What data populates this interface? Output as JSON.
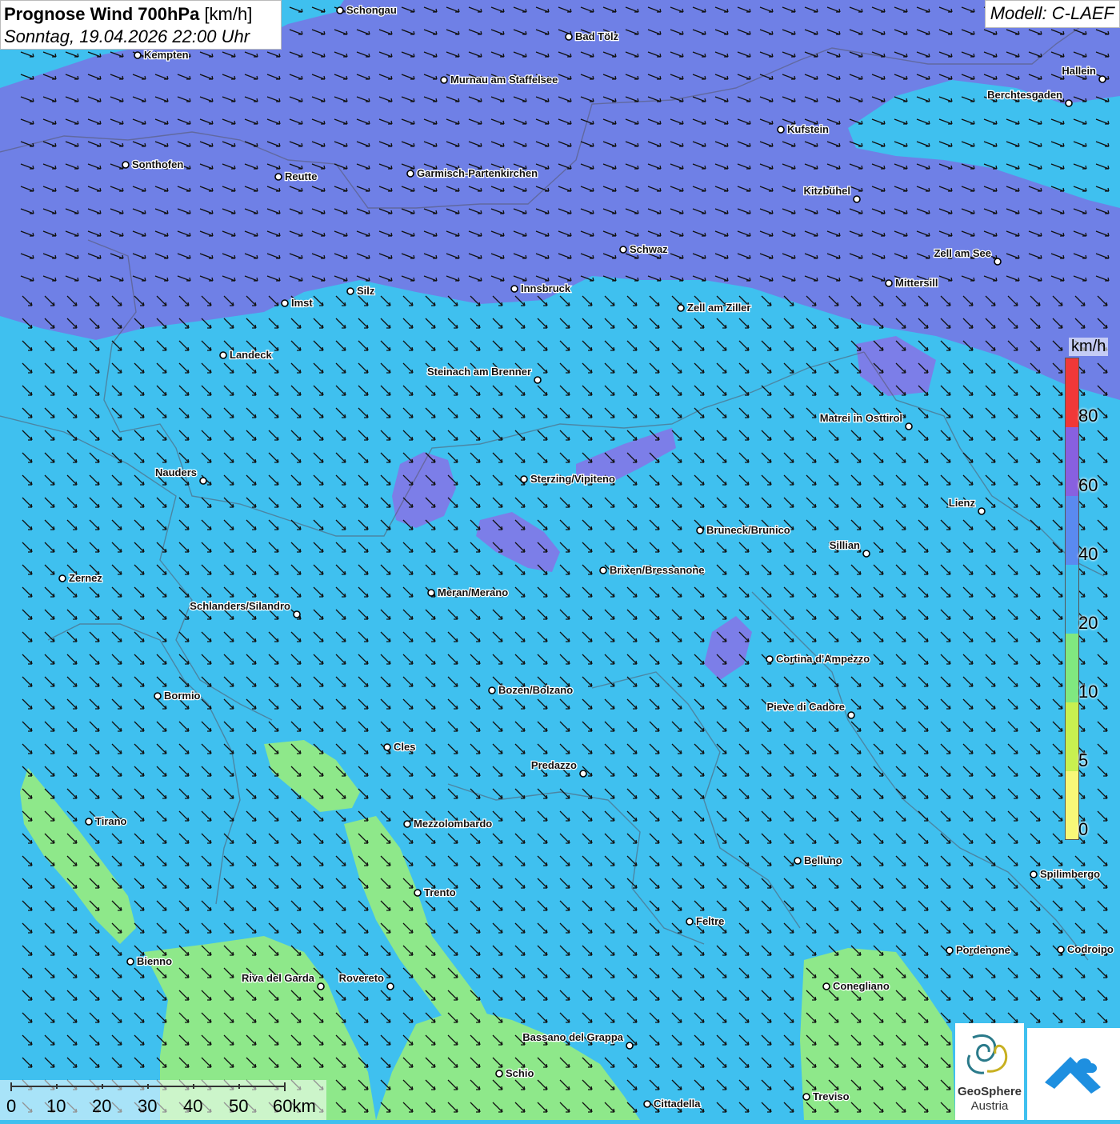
{
  "header": {
    "title_bold": "Prognose Wind 700hPa",
    "title_unit": "[km/h]",
    "datetime": "Sonntag, 19.04.2026 22:00 Uhr"
  },
  "model": {
    "label": "Modell: C-LAEF"
  },
  "legend": {
    "unit": "km/h",
    "labels": [
      "80",
      "60",
      "40",
      "20",
      "10",
      "5",
      "0"
    ],
    "colors": [
      "#f03838",
      "#8860e0",
      "#5a8af0",
      "#3cc0ee",
      "#80e880",
      "#c8f050",
      "#f8f878"
    ]
  },
  "scalebar": {
    "labels": [
      "0",
      "10",
      "20",
      "30",
      "40",
      "50",
      "60km"
    ]
  },
  "logos": {
    "geosphere_line1": "GeoSphere",
    "geosphere_line2": "Austria",
    "geosphere_icon": "geosphere-logo-icon",
    "cloud_icon": "cloud-arrow-logo-icon"
  },
  "wind": {
    "direction": "from north-west",
    "icon": "wind-arrow-icon"
  },
  "colors": {
    "strong_wind": "#6f80e6",
    "medium_wind": "#3fc0ef",
    "light_wind": "#8ee88a",
    "violet_core": "#7c7ee8"
  },
  "cities": [
    {
      "name": "Schongau"
    },
    {
      "name": "Bad Tölz"
    },
    {
      "name": "Kempten"
    },
    {
      "name": "Murnau am Staffelsee"
    },
    {
      "name": "Hallein"
    },
    {
      "name": "Berchtesgaden"
    },
    {
      "name": "Kufstein"
    },
    {
      "name": "Sonthofen"
    },
    {
      "name": "Reutte"
    },
    {
      "name": "Garmisch-Partenkirchen"
    },
    {
      "name": "Kitzbühel"
    },
    {
      "name": "Schwaz"
    },
    {
      "name": "Zell am See"
    },
    {
      "name": "Mittersill"
    },
    {
      "name": "Silz"
    },
    {
      "name": "Innsbruck"
    },
    {
      "name": "Imst"
    },
    {
      "name": "Zell am Ziller"
    },
    {
      "name": "Landeck"
    },
    {
      "name": "Steinach am Brenner"
    },
    {
      "name": "Matrei in Osttirol"
    },
    {
      "name": "Nauders"
    },
    {
      "name": "Sterzing/Vipiteno"
    },
    {
      "name": "Lienz"
    },
    {
      "name": "Bruneck/Brunico"
    },
    {
      "name": "Sillian"
    },
    {
      "name": "Brixen/Bressanone"
    },
    {
      "name": "Zernez"
    },
    {
      "name": "Meran/Merano"
    },
    {
      "name": "Schlanders/Silandro"
    },
    {
      "name": "Cortina d'Ampezzo"
    },
    {
      "name": "Bormio"
    },
    {
      "name": "Bozen/Bolzano"
    },
    {
      "name": "Pieve di Cadore"
    },
    {
      "name": "Cles"
    },
    {
      "name": "Predazzo"
    },
    {
      "name": "Tirano"
    },
    {
      "name": "Mezzolombardo"
    },
    {
      "name": "Belluno"
    },
    {
      "name": "Spilimbergo"
    },
    {
      "name": "Trento"
    },
    {
      "name": "Feltre"
    },
    {
      "name": "Bienno"
    },
    {
      "name": "Pordenone"
    },
    {
      "name": "Codroipo"
    },
    {
      "name": "Riva del Garda"
    },
    {
      "name": "Rovereto"
    },
    {
      "name": "Conegliano"
    },
    {
      "name": "Bassano del Grappa"
    },
    {
      "name": "Schio"
    },
    {
      "name": "Treviso"
    },
    {
      "name": "Cittadella"
    }
  ]
}
